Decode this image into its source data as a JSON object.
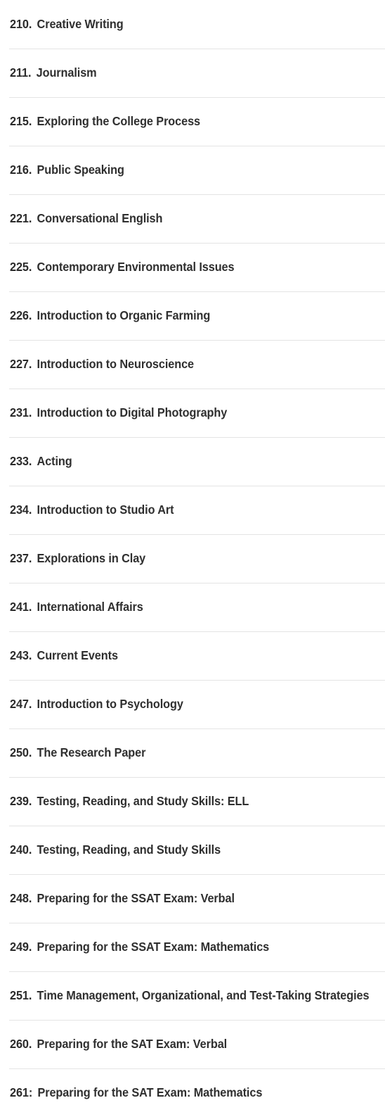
{
  "list": {
    "separator_period": ".",
    "separator_colon": ":",
    "courses": [
      {
        "number": "210",
        "separator": ".",
        "title": "Creative Writing"
      },
      {
        "number": "211",
        "separator": ".",
        "title": "Journalism"
      },
      {
        "number": "215",
        "separator": ".",
        "title": "Exploring the College Process"
      },
      {
        "number": "216",
        "separator": ".",
        "title": "Public Speaking"
      },
      {
        "number": "221",
        "separator": ".",
        "title": "Conversational English"
      },
      {
        "number": "225",
        "separator": ".",
        "title": "Contemporary Environmental Issues"
      },
      {
        "number": "226",
        "separator": ".",
        "title": "Introduction to Organic Farming"
      },
      {
        "number": "227",
        "separator": ".",
        "title": "Introduction to Neuroscience"
      },
      {
        "number": "231",
        "separator": ".",
        "title": "Introduction to Digital Photography"
      },
      {
        "number": "233",
        "separator": ".",
        "title": "Acting"
      },
      {
        "number": "234",
        "separator": ".",
        "title": "Introduction to Studio Art"
      },
      {
        "number": "237",
        "separator": ".",
        "title": "Explorations in Clay"
      },
      {
        "number": "241",
        "separator": ".",
        "title": "International Affairs"
      },
      {
        "number": "243",
        "separator": ".",
        "title": "Current Events"
      },
      {
        "number": "247",
        "separator": ".",
        "title": "Introduction to Psychology"
      },
      {
        "number": "250",
        "separator": ".",
        "title": "The Research Paper"
      },
      {
        "number": "239",
        "separator": ".",
        "title": "Testing, Reading, and Study Skills: ELL"
      },
      {
        "number": "240",
        "separator": ".",
        "title": "Testing, Reading, and Study Skills"
      },
      {
        "number": "248",
        "separator": ".",
        "title": "Preparing for the SSAT Exam: Verbal"
      },
      {
        "number": "249",
        "separator": ".",
        "title": "Preparing for the SSAT Exam: Mathematics"
      },
      {
        "number": "251",
        "separator": ".",
        "title": "Time Management, Organizational, and Test-Taking Strategies"
      },
      {
        "number": "260",
        "separator": ".",
        "title": "Preparing for the SAT Exam: Verbal"
      },
      {
        "number": "261",
        "separator": ":",
        "title": "Preparing for the SAT Exam: Mathematics"
      }
    ]
  },
  "colors": {
    "background": "#ffffff",
    "text": "#2d2d2d",
    "number": "#2b2b2b",
    "divider": "#e4e4e4"
  }
}
